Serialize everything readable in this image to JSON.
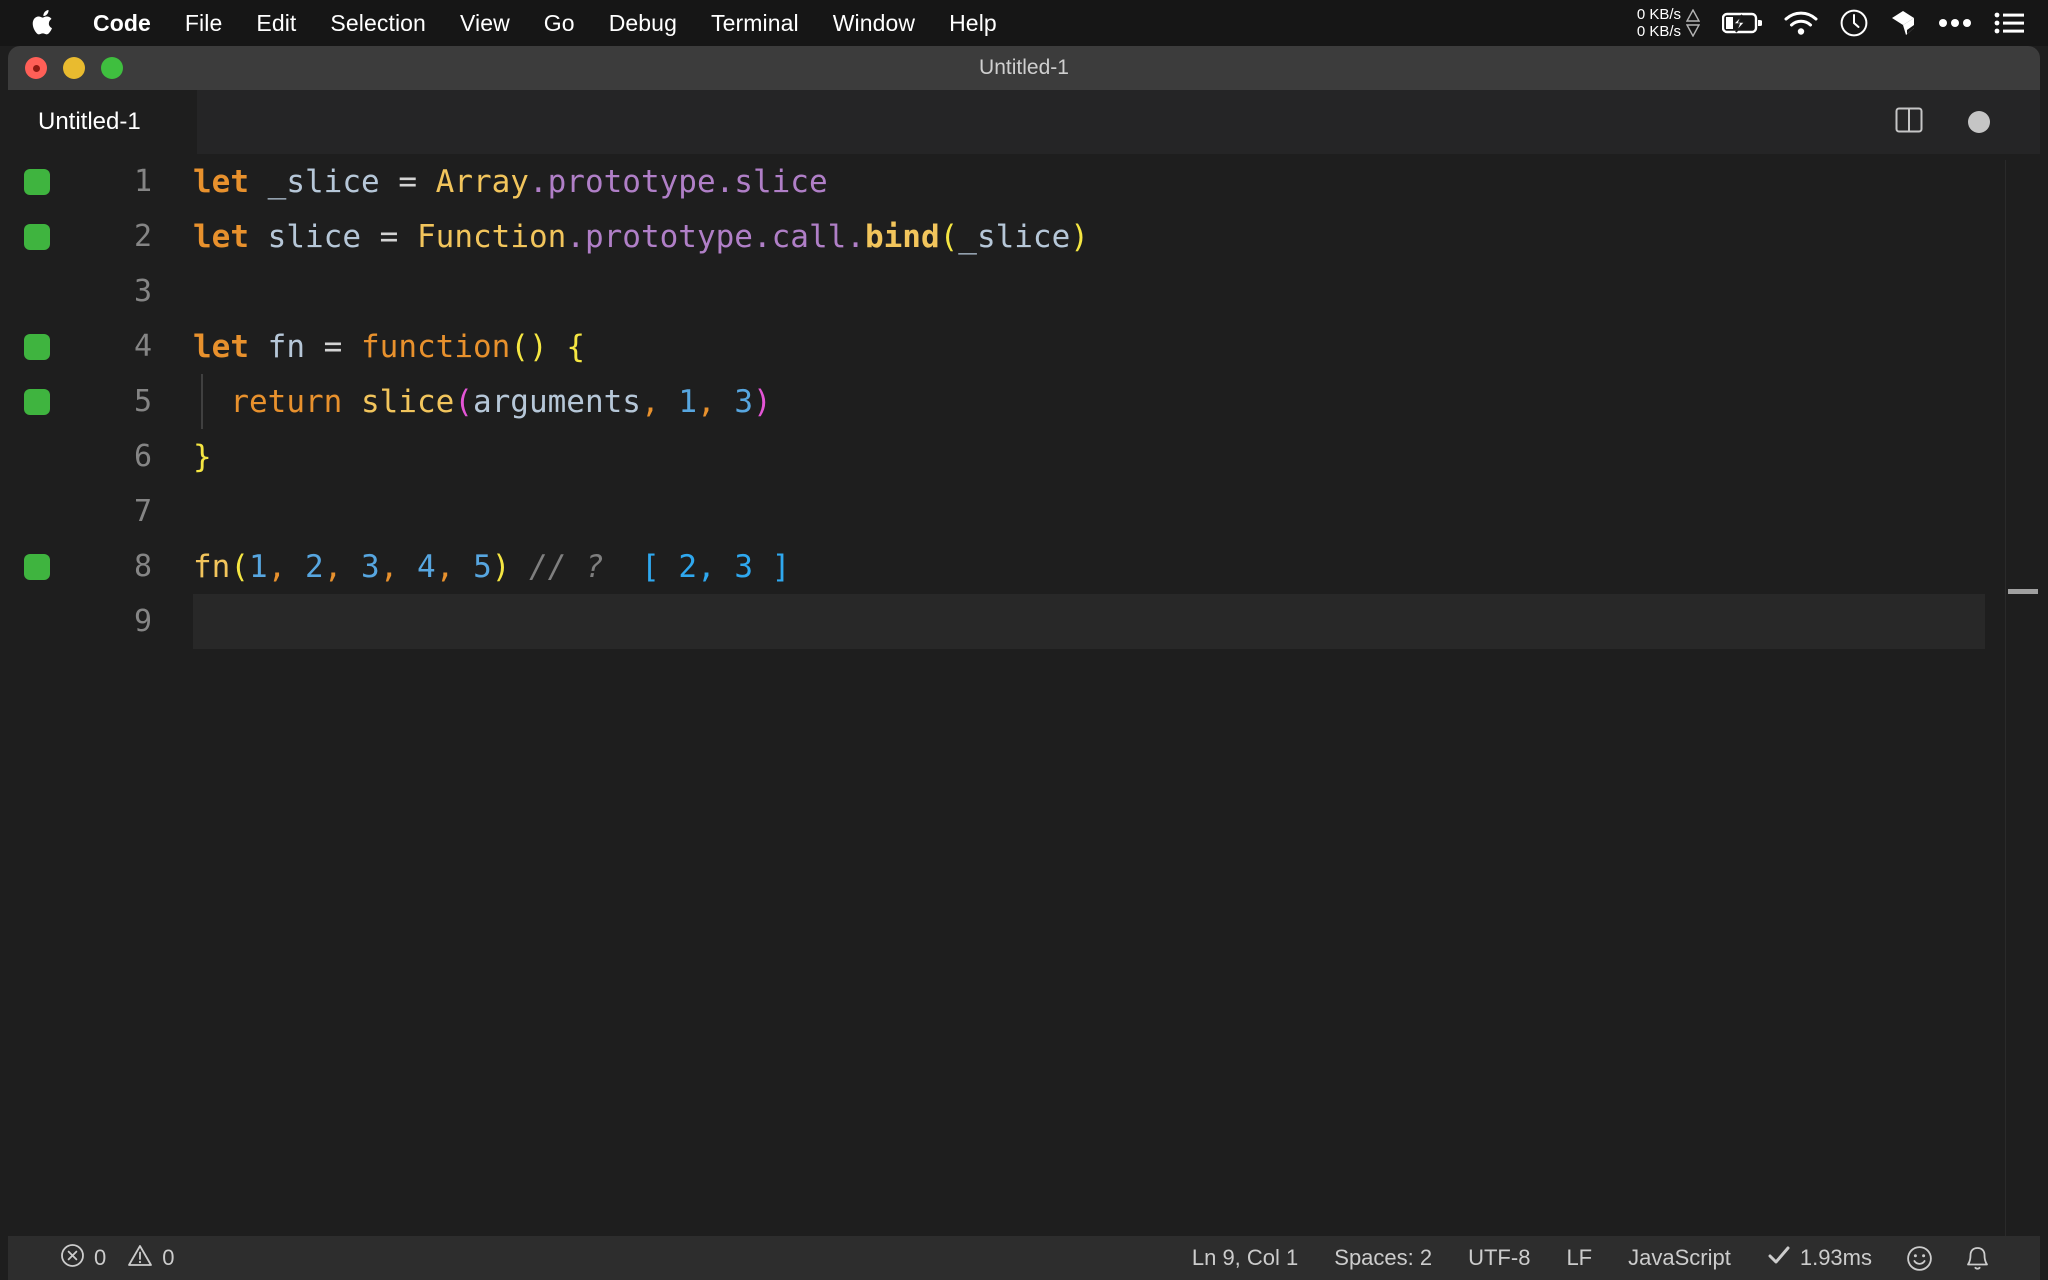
{
  "menubar": {
    "apple_icon": "apple-logo-icon",
    "items": [
      {
        "label": "Code",
        "bold": true
      },
      {
        "label": "File",
        "bold": false
      },
      {
        "label": "Edit",
        "bold": false
      },
      {
        "label": "Selection",
        "bold": false
      },
      {
        "label": "View",
        "bold": false
      },
      {
        "label": "Go",
        "bold": false
      },
      {
        "label": "Debug",
        "bold": false
      },
      {
        "label": "Terminal",
        "bold": false
      },
      {
        "label": "Window",
        "bold": false
      },
      {
        "label": "Help",
        "bold": false
      }
    ],
    "network": {
      "upload": "0 KB/s",
      "download": "0 KB/s"
    },
    "tray_icons": [
      "battery-charging-icon",
      "wifi-icon",
      "clock-icon",
      "dropbox-icon",
      "ellipsis-icon",
      "list-menu-icon"
    ]
  },
  "window": {
    "title": "Untitled-1",
    "traffic_lights": [
      "close-button",
      "minimize-button",
      "maximize-button"
    ]
  },
  "tabs": [
    {
      "label": "Untitled-1",
      "active": true,
      "dirty": true
    }
  ],
  "tabbar_actions": [
    "split-editor-icon",
    "unsaved-dot-indicator"
  ],
  "editor": {
    "language": "JavaScript",
    "lines": [
      {
        "number": "1",
        "marker": true,
        "current": false,
        "indent_guide": false,
        "tokens": [
          {
            "t": "let",
            "c": "t-kw"
          },
          {
            "t": " ",
            "c": "t-op"
          },
          {
            "t": "_slice",
            "c": "t-var"
          },
          {
            "t": " = ",
            "c": "t-op"
          },
          {
            "t": "Array",
            "c": "t-cls"
          },
          {
            "t": ".prototype",
            "c": "t-prop"
          },
          {
            "t": ".slice",
            "c": "t-prop"
          }
        ]
      },
      {
        "number": "2",
        "marker": true,
        "current": false,
        "indent_guide": false,
        "tokens": [
          {
            "t": "let",
            "c": "t-kw"
          },
          {
            "t": " ",
            "c": "t-op"
          },
          {
            "t": "slice",
            "c": "t-var"
          },
          {
            "t": " = ",
            "c": "t-op"
          },
          {
            "t": "Function",
            "c": "t-cls"
          },
          {
            "t": ".prototype",
            "c": "t-prop"
          },
          {
            "t": ".call",
            "c": "t-prop"
          },
          {
            "t": ".",
            "c": "t-prop"
          },
          {
            "t": "bind",
            "c": "t-fn"
          },
          {
            "t": "(",
            "c": "t-br-y"
          },
          {
            "t": "_slice",
            "c": "t-var"
          },
          {
            "t": ")",
            "c": "t-br-y"
          }
        ]
      },
      {
        "number": "3",
        "marker": false,
        "current": false,
        "indent_guide": false,
        "tokens": []
      },
      {
        "number": "4",
        "marker": true,
        "current": false,
        "indent_guide": false,
        "tokens": [
          {
            "t": "let",
            "c": "t-kw"
          },
          {
            "t": " ",
            "c": "t-op"
          },
          {
            "t": "fn",
            "c": "t-var"
          },
          {
            "t": " = ",
            "c": "t-op"
          },
          {
            "t": "function",
            "c": "t-kw2"
          },
          {
            "t": "()",
            "c": "t-br-y"
          },
          {
            "t": " ",
            "c": "t-op"
          },
          {
            "t": "{",
            "c": "t-br-y"
          }
        ]
      },
      {
        "number": "5",
        "marker": true,
        "current": false,
        "indent_guide": true,
        "tokens": [
          {
            "t": "  ",
            "c": "t-op"
          },
          {
            "t": "return",
            "c": "t-kw2"
          },
          {
            "t": " ",
            "c": "t-op"
          },
          {
            "t": "slice",
            "c": "t-fn2"
          },
          {
            "t": "(",
            "c": "t-br-m"
          },
          {
            "t": "arguments",
            "c": "t-var"
          },
          {
            "t": ",",
            "c": "t-comma"
          },
          {
            "t": " ",
            "c": "t-op"
          },
          {
            "t": "1",
            "c": "t-num"
          },
          {
            "t": ",",
            "c": "t-comma"
          },
          {
            "t": " ",
            "c": "t-op"
          },
          {
            "t": "3",
            "c": "t-num"
          },
          {
            "t": ")",
            "c": "t-br-m"
          }
        ]
      },
      {
        "number": "6",
        "marker": false,
        "current": false,
        "indent_guide": false,
        "tokens": [
          {
            "t": "}",
            "c": "t-br-y"
          }
        ]
      },
      {
        "number": "7",
        "marker": false,
        "current": false,
        "indent_guide": false,
        "tokens": []
      },
      {
        "number": "8",
        "marker": true,
        "current": false,
        "indent_guide": false,
        "tokens": [
          {
            "t": "fn",
            "c": "t-fn2"
          },
          {
            "t": "(",
            "c": "t-br-y"
          },
          {
            "t": "1",
            "c": "t-num"
          },
          {
            "t": ",",
            "c": "t-comma"
          },
          {
            "t": " ",
            "c": "t-op"
          },
          {
            "t": "2",
            "c": "t-num"
          },
          {
            "t": ",",
            "c": "t-comma"
          },
          {
            "t": " ",
            "c": "t-op"
          },
          {
            "t": "3",
            "c": "t-num"
          },
          {
            "t": ",",
            "c": "t-comma"
          },
          {
            "t": " ",
            "c": "t-op"
          },
          {
            "t": "4",
            "c": "t-num"
          },
          {
            "t": ",",
            "c": "t-comma"
          },
          {
            "t": " ",
            "c": "t-op"
          },
          {
            "t": "5",
            "c": "t-num"
          },
          {
            "t": ")",
            "c": "t-br-y"
          },
          {
            "t": " ",
            "c": "t-op"
          },
          {
            "t": "// ?",
            "c": "t-comment"
          },
          {
            "t": "  ",
            "c": "t-op"
          },
          {
            "t": "[ 2, 3 ]",
            "c": "t-cmt-blue"
          }
        ]
      },
      {
        "number": "9",
        "marker": false,
        "current": true,
        "indent_guide": false,
        "tokens": []
      }
    ]
  },
  "statusbar": {
    "errors": "0",
    "warnings": "0",
    "cursor_position": "Ln 9, Col 1",
    "indentation": "Spaces: 2",
    "encoding": "UTF-8",
    "eol": "LF",
    "language": "JavaScript",
    "quokka_time": "1.93ms",
    "icons": [
      "error-icon",
      "warning-icon",
      "check-icon",
      "smiley-feedback-icon",
      "bell-notification-icon"
    ]
  },
  "colors": {
    "accent_green": "#3fb43f",
    "editor_bg": "#1e1e1e",
    "statusbar_bg": "#2d2d2d",
    "tabbar_bg": "#252526",
    "titlebar_bg": "#3c3c3c"
  }
}
